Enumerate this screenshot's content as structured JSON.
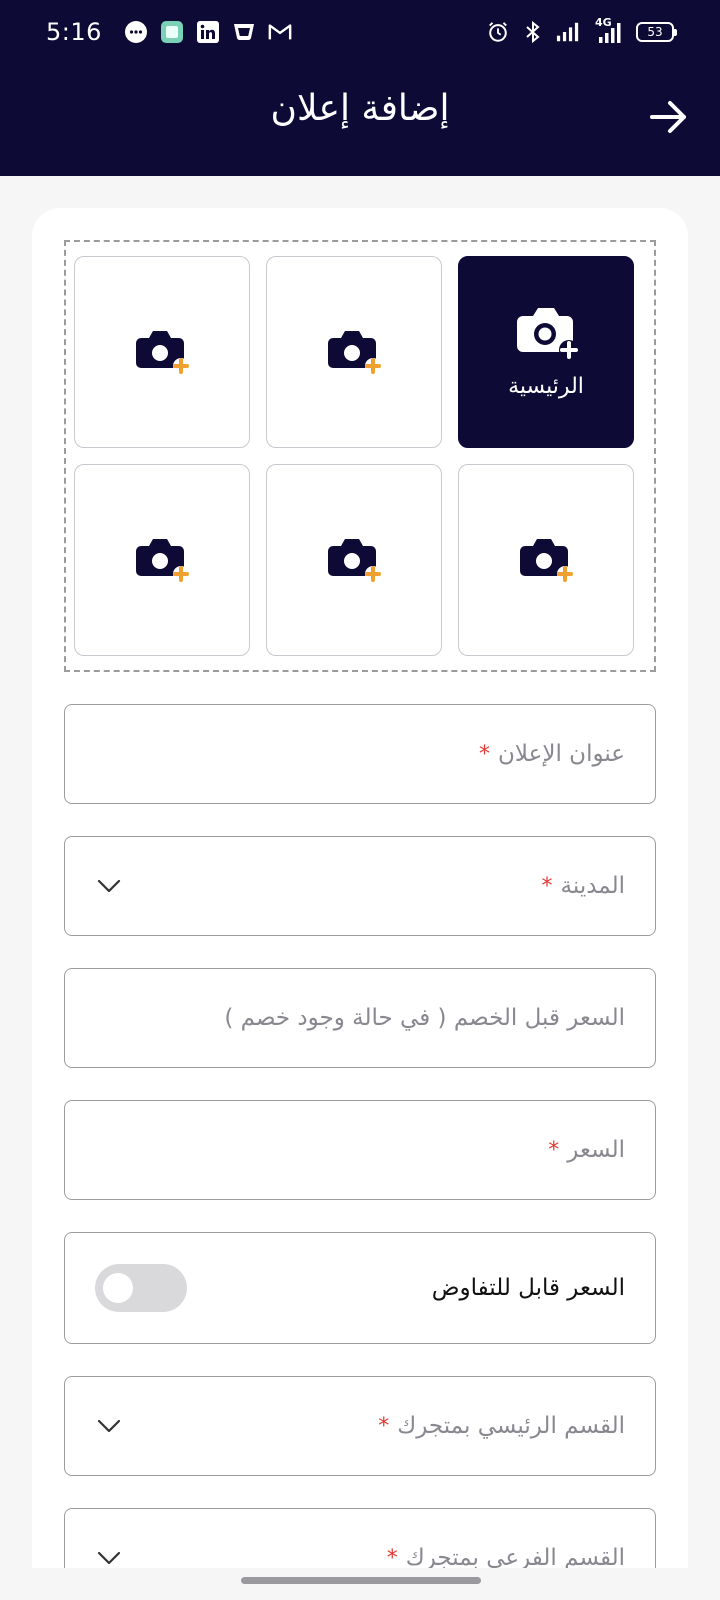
{
  "status_bar": {
    "time": "5:16",
    "battery": "53",
    "network": "4G",
    "notification_icons": [
      "chat-bubble-icon",
      "layers-app-icon",
      "linkedin-icon",
      "cup-app-icon",
      "gmail-icon"
    ],
    "system_icons": [
      "alarm-icon",
      "bluetooth-icon",
      "signal-icon",
      "signal-4g-icon",
      "battery-icon"
    ]
  },
  "header": {
    "title": "إضافة إعلان",
    "back_icon": "arrow-right-icon"
  },
  "photos": {
    "main_label": "الرئيسية",
    "slot_icon": "camera-plus-icon"
  },
  "form": {
    "ad_title": {
      "placeholder": "عنوان الإعلان",
      "required_mark": "*"
    },
    "city": {
      "placeholder": "المدينة",
      "required_mark": "*"
    },
    "price_before_discount": {
      "placeholder": "السعر قبل الخصم ( في حالة وجود خصم )"
    },
    "price": {
      "placeholder": "السعر",
      "required_mark": "*"
    },
    "negotiable": {
      "label": "السعر قابل للتفاوض",
      "enabled": false
    },
    "main_category": {
      "placeholder": "القسم الرئيسي بمتجرك",
      "required_mark": "*"
    },
    "sub_category": {
      "placeholder": "القسم الفرعي بمتجرك",
      "required_mark": "*"
    }
  },
  "colors": {
    "primary": "#0d0a35",
    "accent": "#f0a030",
    "required": "#e53935"
  }
}
